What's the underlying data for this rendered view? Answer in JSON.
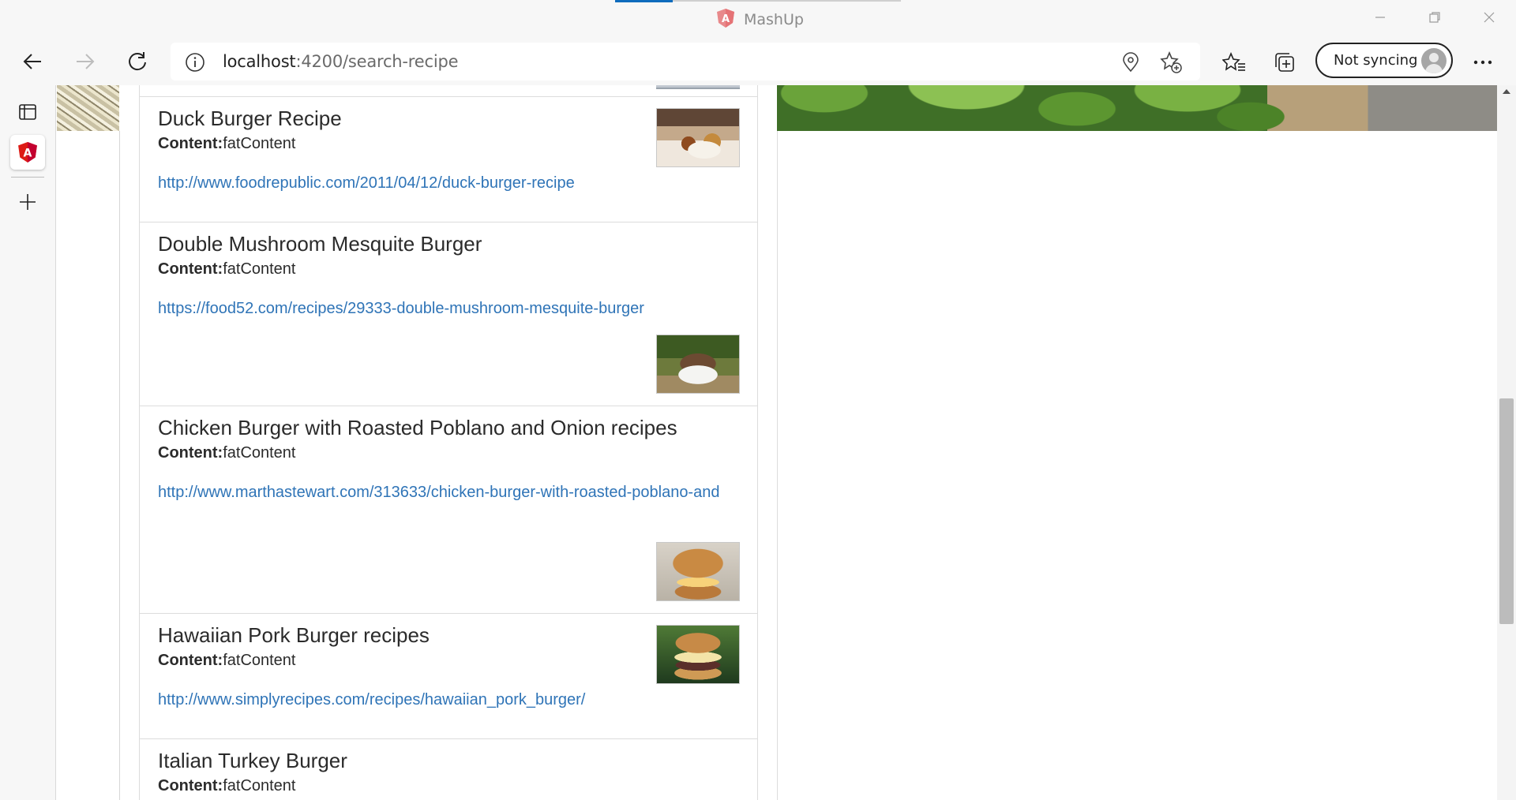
{
  "window": {
    "title": "MashUp",
    "accent_color": "#0f6cbd",
    "controls": [
      "minimize-icon",
      "restore-icon",
      "close-icon"
    ]
  },
  "toolbar": {
    "url_host": "localhost",
    "url_rest": ":4200/search-recipe",
    "sync_label": "Not syncing",
    "icons": [
      "back-arrow-icon",
      "forward-arrow-icon",
      "refresh-icon",
      "site-info-icon",
      "location-icon",
      "add-favorite-icon",
      "favorites-icon",
      "collections-icon",
      "more-icon"
    ]
  },
  "vertical_tabs": {
    "icons": [
      "tab-actions-icon",
      "angular-tab-icon",
      "new-tab-icon"
    ]
  },
  "content": {
    "label_prefix": "Content:",
    "recipes": [
      {
        "title": "Duck Burger Recipe",
        "content": "fatContent",
        "url": "http://www.foodrepublic.com/2011/04/12/duck-burger-recipe",
        "image": "duck-burger-photo"
      },
      {
        "title": "Double Mushroom Mesquite Burger",
        "content": "fatContent",
        "url": "https://food52.com/recipes/29333-double-mushroom-mesquite-burger",
        "image": "mushroom-burger-photo"
      },
      {
        "title": "Chicken Burger with Roasted Poblano and Onion recipes",
        "content": "fatContent",
        "url": "http://www.marthastewart.com/313633/chicken-burger-with-roasted-poblano-and",
        "image": "chicken-burger-photo"
      },
      {
        "title": "Hawaiian Pork Burger recipes",
        "content": "fatContent",
        "url": "http://www.simplyrecipes.com/recipes/hawaiian_pork_burger/",
        "image": "pork-burger-photo"
      },
      {
        "title": "Italian Turkey Burger",
        "content": "fatContent"
      }
    ]
  }
}
